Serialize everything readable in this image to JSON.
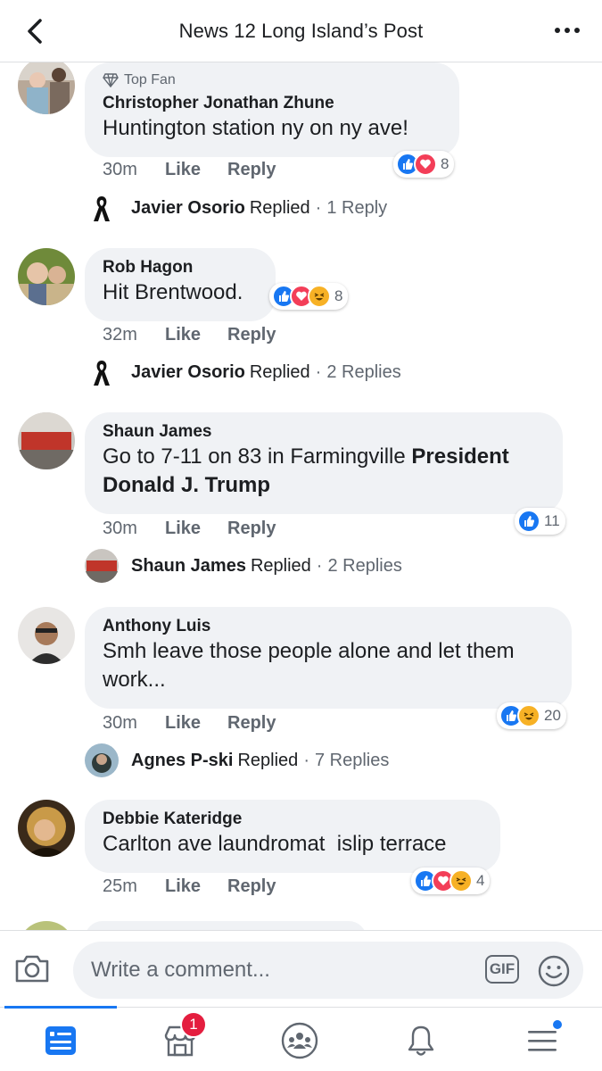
{
  "header": {
    "title": "News 12 Long Island’s Post"
  },
  "comments": [
    {
      "badge": "Top Fan",
      "name": "Christopher Jonathan Zhune",
      "text": "Huntington station ny on ny ave!",
      "time": "30m",
      "like_label": "Like",
      "reply_label": "Reply",
      "reactions": [
        "like",
        "love"
      ],
      "reaction_count": "8",
      "reply": {
        "name": "Javier Osorio",
        "verb": "Replied",
        "sep": "·",
        "count": "1 Reply"
      }
    },
    {
      "name": "Rob Hagon",
      "text": "Hit Brentwood.",
      "time": "32m",
      "like_label": "Like",
      "reply_label": "Reply",
      "reactions": [
        "like",
        "love",
        "haha"
      ],
      "reaction_count": "8",
      "reply": {
        "name": "Javier Osorio",
        "verb": "Replied",
        "sep": "·",
        "count": "2 Replies"
      }
    },
    {
      "name": "Shaun James",
      "text": "Go to 7-11 on 83 in Farmingville ",
      "text_bold": "President Donald J. Trump",
      "time": "30m",
      "like_label": "Like",
      "reply_label": "Reply",
      "reactions": [
        "like"
      ],
      "reaction_count": "11",
      "reply": {
        "name": "Shaun James",
        "verb": "Replied",
        "sep": "·",
        "count": "2 Replies"
      }
    },
    {
      "name": "Anthony Luis",
      "text": "Smh leave those people alone and let them work...",
      "time": "30m",
      "like_label": "Like",
      "reply_label": "Reply",
      "reactions": [
        "like",
        "haha"
      ],
      "reaction_count": "20",
      "reply": {
        "name": "Agnes P-ski",
        "verb": "Replied",
        "sep": "·",
        "count": "7 Replies"
      }
    },
    {
      "name": "Debbie Kateridge",
      "text": "Carlton ave laundromat  islip terrace",
      "time": "25m",
      "like_label": "Like",
      "reply_label": "Reply",
      "reactions": [
        "like",
        "love",
        "haha"
      ],
      "reaction_count": "4"
    }
  ],
  "composer": {
    "placeholder": "Write a comment...",
    "gif_label": "GIF"
  },
  "tabbar": {
    "tabs": [
      "news-feed",
      "marketplace",
      "groups",
      "notifications",
      "menu"
    ],
    "marketplace_badge": "1"
  },
  "colors": {
    "accent": "#1877f2",
    "like": "#1877f2",
    "love": "#f33e58",
    "haha": "#f7b125",
    "badge": "#e41e3f"
  }
}
